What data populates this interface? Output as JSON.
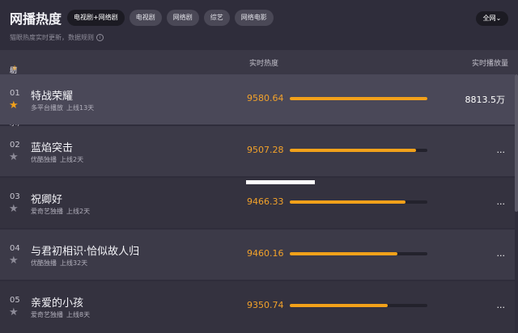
{
  "header": {
    "title": "网播热度",
    "tabs": [
      "电视剧+网络剧",
      "电视剧",
      "网络剧",
      "综艺",
      "网络电影"
    ],
    "subtitle": "猫眼热度实时更新，数据规则",
    "info_icon": "i",
    "region": "全网⌄"
  },
  "columns": {
    "name_prefix": "剧集(点击",
    "name_star": "★",
    "name_suffix": "切换右侧展示)",
    "heat": "实时热度",
    "play": "实时播放量"
  },
  "rows": [
    {
      "rank": "01",
      "name": "特战荣耀",
      "platform": "多平台播放",
      "days": "上线13天",
      "heat": "9580.64",
      "heat_fill": 1.0,
      "play": "8813.5万",
      "starred": true
    },
    {
      "rank": "02",
      "name": "蓝焰突击",
      "platform": "优酷独播",
      "days": "上线2天",
      "heat": "9507.28",
      "heat_fill": 0.92,
      "play": "...",
      "starred": false
    },
    {
      "rank": "03",
      "name": "祝卿好",
      "platform": "爱奇艺独播",
      "days": "上线2天",
      "heat": "9466.33",
      "heat_fill": 0.84,
      "play": "...",
      "starred": false
    },
    {
      "rank": "04",
      "name": "与君初相识·恰似故人归",
      "platform": "优酷独播",
      "days": "上线32天",
      "heat": "9460.16",
      "heat_fill": 0.78,
      "play": "...",
      "starred": false
    },
    {
      "rank": "05",
      "name": "亲爱的小孩",
      "platform": "爱奇艺独播",
      "days": "上线8天",
      "heat": "9350.74",
      "heat_fill": 0.71,
      "play": "...",
      "starred": false
    }
  ],
  "colors": {
    "accent": "#f2a11a",
    "background": "#2f2d3b",
    "highlight_row": "#4a4858",
    "row_alt": "#3c3a48"
  }
}
